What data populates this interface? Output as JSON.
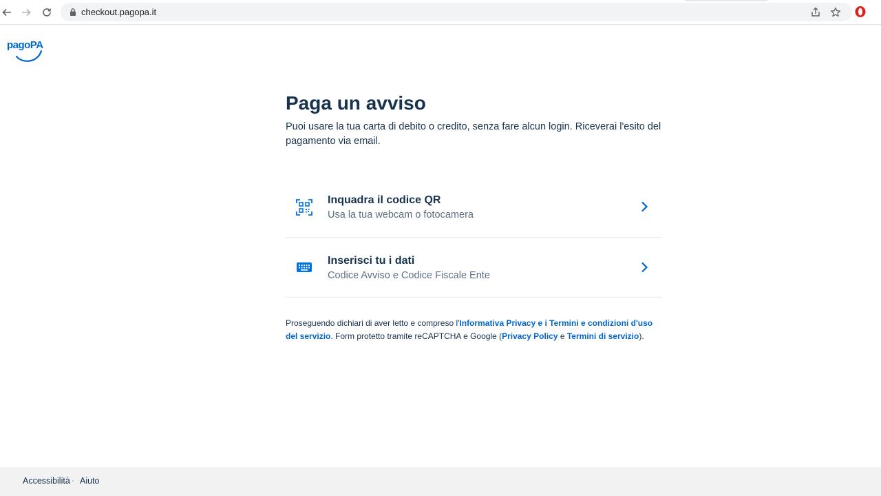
{
  "browser": {
    "url": "checkout.pagopa.it"
  },
  "logo": {
    "text": "pagoPA"
  },
  "main": {
    "title": "Paga un avviso",
    "subtitle": "Puoi usare la tua carta di debito o credito, senza fare alcun login. Riceverai l'esito del pagamento via email."
  },
  "options": [
    {
      "title": "Inquadra il codice QR",
      "description": "Usa la tua webcam o fotocamera",
      "icon": "qr-code-icon"
    },
    {
      "title": "Inserisci tu i dati",
      "description": "Codice Avviso e Codice Fiscale Ente",
      "icon": "keyboard-icon"
    }
  ],
  "legal": {
    "prefix": "Proseguendo dichiari di aver letto e compreso l'",
    "link_privacy_terms": "Informativa Privacy e i Termini e condizioni d'uso del servizio",
    "middle": ". Form protetto tramite reCAPTCHA e Google (",
    "link_privacy_policy": "Privacy Policy",
    "conj": " e ",
    "link_terms_service": "Termini di servizio",
    "suffix": ")."
  },
  "footer": {
    "accessibility": "Accessibilità",
    "separator": "·",
    "help": "Aiuto"
  },
  "colors": {
    "brand": "#0066cc",
    "text": "#17324d",
    "muted": "#5c6f82",
    "footer_bg": "#f2f2f2"
  }
}
